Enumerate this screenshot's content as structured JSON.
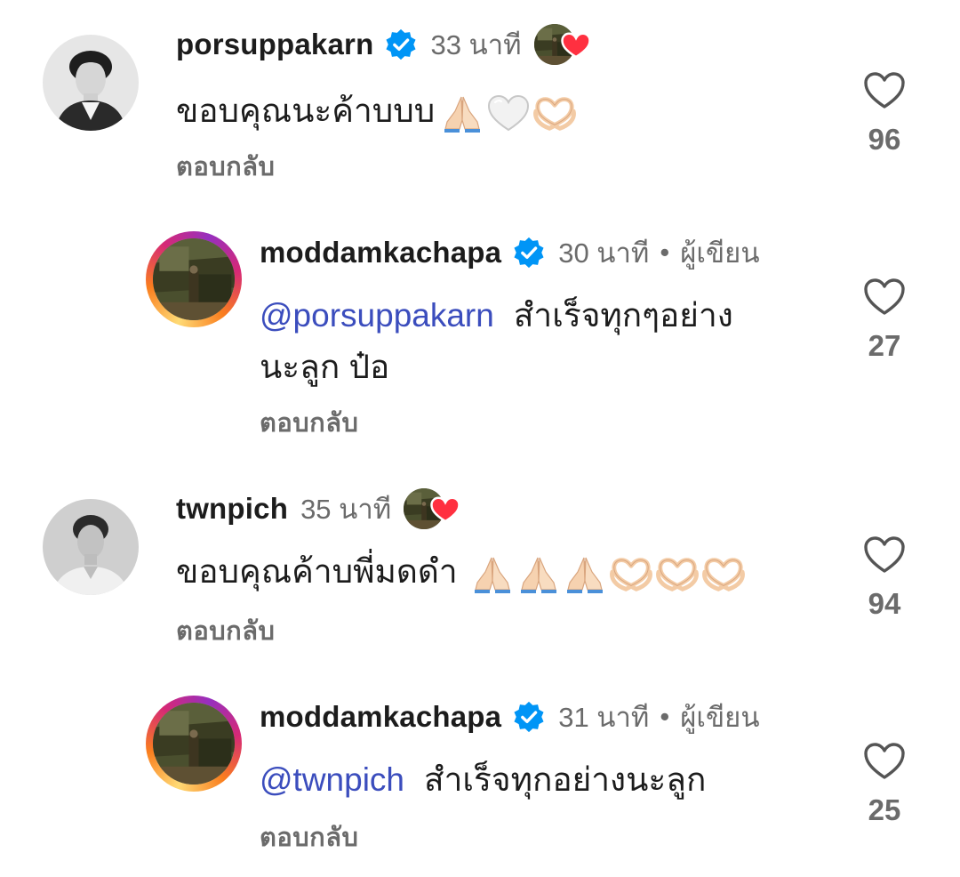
{
  "comments": [
    {
      "username": "porsuppakarn",
      "verified": true,
      "time": "33 นาที",
      "text": "ขอบคุณนะค้าบบบ",
      "emojis": [
        "folded-hands",
        "white-heart",
        "heart-hands"
      ],
      "reply_label": "ตอบกลับ",
      "likes": "96",
      "liked_by_author": true
    },
    {
      "username": "moddamkachapa",
      "verified": true,
      "time": "30 นาที",
      "separator": "•",
      "author_label": "ผู้เขียน",
      "mention": "@porsuppakarn",
      "text_line1": "สำเร็จทุกๆอย่าง",
      "text_line2": "นะลูก ป๋อ",
      "reply_label": "ตอบกลับ",
      "likes": "27"
    },
    {
      "username": "twnpich",
      "verified": false,
      "time": "35 นาที",
      "text": "ขอบคุณค้าบพี่มดดำ",
      "emojis": [
        "folded-hands",
        "folded-hands",
        "folded-hands",
        "heart-hands",
        "heart-hands",
        "heart-hands"
      ],
      "reply_label": "ตอบกลับ",
      "likes": "94",
      "liked_by_author": true
    },
    {
      "username": "moddamkachapa",
      "verified": true,
      "time": "31 นาที",
      "separator": "•",
      "author_label": "ผู้เขียน",
      "mention": "@twnpich",
      "text": "สำเร็จทุกอย่างนะลูก",
      "reply_label": "ตอบกลับ",
      "likes": "25"
    }
  ],
  "colors": {
    "verified_blue": "#0095f6",
    "mention_blue": "#3b4dbd",
    "like_red": "#ff3040",
    "secondary_text": "#6b6b6b"
  }
}
